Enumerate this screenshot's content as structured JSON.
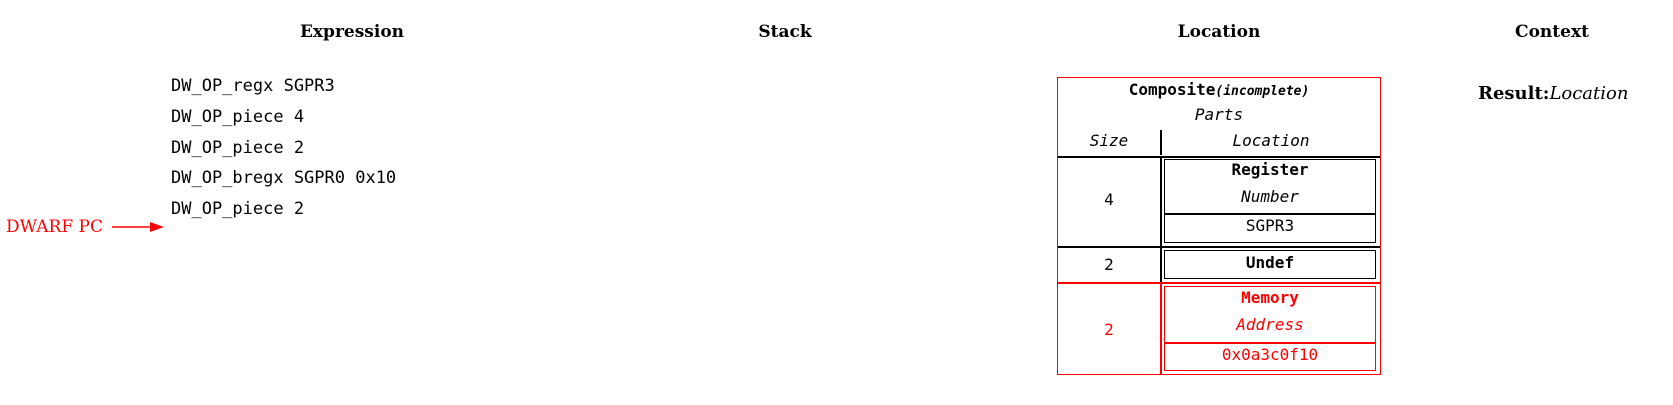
{
  "headers": {
    "expression": "Expression",
    "stack": "Stack",
    "location": "Location",
    "context": "Context"
  },
  "expression": {
    "lines": [
      "DW_OP_regx SGPR3",
      "DW_OP_piece 4",
      "DW_OP_piece 2",
      "DW_OP_bregx SGPR0 0x10",
      "DW_OP_piece 2"
    ],
    "pc_label": "DWARF PC"
  },
  "location": {
    "composite_title": "Composite",
    "composite_state": "(incomplete)",
    "parts_label": "Parts",
    "col_size": "Size",
    "col_location": "Location",
    "parts": [
      {
        "size": "4",
        "kind": "Register",
        "field": "Number",
        "value": "SGPR3"
      },
      {
        "size": "2",
        "kind": "Undef"
      },
      {
        "size": "2",
        "kind": "Memory",
        "field": "Address",
        "value": "0x0a3c0f10"
      }
    ]
  },
  "context": {
    "result_label": "Result:",
    "result_value": "Location"
  },
  "colors": {
    "highlight": "#ff0000",
    "text": "#000000"
  }
}
